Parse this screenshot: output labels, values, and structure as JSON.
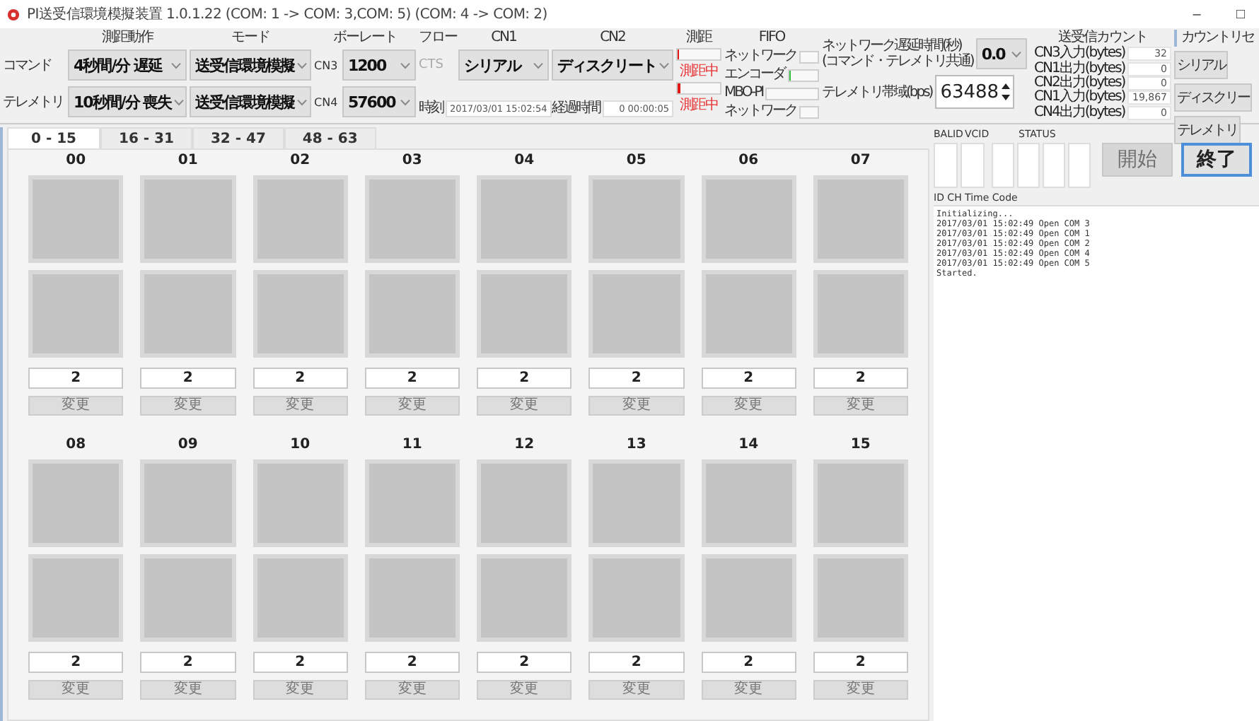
{
  "window": {
    "title": "PI送受信環境模擬装置 1.0.1.22 (COM: 1 -> COM: 3,COM: 5) (COM: 4 -> COM: 2)",
    "buttons": [
      "–",
      "□"
    ]
  },
  "settings": {
    "headers": {
      "action": "測距動作",
      "mode": "モード",
      "baud": "ボーレート",
      "flow": "フロー",
      "cn1": "CN1",
      "cn2": "CN2"
    },
    "rows": [
      {
        "label": "コマンド",
        "action": "4秒間/分 遅延",
        "mode": "送受信環境模擬",
        "port": "CN3",
        "baud": "1200"
      },
      {
        "label": "テレメトリ",
        "action": "10秒間/分 喪失",
        "mode": "送受信環境模擬",
        "port": "CN4",
        "baud": "57600"
      }
    ],
    "flow": "CTS",
    "cn1": "シリアル",
    "cn2": "ディスクリート",
    "time": {
      "label": "時刻",
      "value": "2017/03/01 15:02:54"
    },
    "elapsed": {
      "label": "経過時間",
      "value": "0 00:00:05"
    }
  },
  "ranging": {
    "header": "測距",
    "rows": [
      {
        "level": 0.04,
        "status": "測距中"
      },
      {
        "level": 0.06,
        "status": "測距中"
      }
    ]
  },
  "fifo": {
    "header": "FIFO",
    "rows": [
      {
        "label": "ネットワーク"
      },
      {
        "label": "エンコーダ",
        "level": 0.06
      },
      {
        "label": "MBO-PI"
      },
      {
        "label": "ネットワーク"
      }
    ]
  },
  "network": {
    "delay_label": "ネットワーク遅延時間(秒)\n(コマンド・テレメトリ共通)",
    "delay": "0.0",
    "bandwidth_label": "テレメトリ帯域(bps)",
    "bandwidth": "63488"
  },
  "counts": {
    "header": "送受信カウント",
    "rows": [
      {
        "label": "CN3入力(bytes)",
        "value": "32"
      },
      {
        "label": "CN1出力(bytes)",
        "value": "0"
      },
      {
        "label": "CN2出力(bytes)",
        "value": "0"
      },
      {
        "label": "CN1入力(bytes)",
        "value": "19,867"
      },
      {
        "label": "CN4出力(bytes)",
        "value": "0"
      }
    ]
  },
  "reset": {
    "header": "カウントリセ",
    "buttons": [
      "シリアル",
      "ディスクリー",
      "テレメトリ"
    ]
  },
  "tabs": [
    {
      "label": "0 - 15",
      "selected": true
    },
    {
      "label": "16 - 31",
      "selected": false
    },
    {
      "label": "32 - 47",
      "selected": false
    },
    {
      "label": "48 - 63",
      "selected": false
    }
  ],
  "channels": [
    {
      "id": "00",
      "value": "2",
      "button": "変更"
    },
    {
      "id": "01",
      "value": "2",
      "button": "変更"
    },
    {
      "id": "02",
      "value": "2",
      "button": "変更"
    },
    {
      "id": "03",
      "value": "2",
      "button": "変更"
    },
    {
      "id": "04",
      "value": "2",
      "button": "変更"
    },
    {
      "id": "05",
      "value": "2",
      "button": "変更"
    },
    {
      "id": "06",
      "value": "2",
      "button": "変更"
    },
    {
      "id": "07",
      "value": "2",
      "button": "変更"
    },
    {
      "id": "08",
      "value": "2",
      "button": "変更"
    },
    {
      "id": "09",
      "value": "2",
      "button": "変更"
    },
    {
      "id": "10",
      "value": "2",
      "button": "変更"
    },
    {
      "id": "11",
      "value": "2",
      "button": "変更"
    },
    {
      "id": "12",
      "value": "2",
      "button": "変更"
    },
    {
      "id": "13",
      "value": "2",
      "button": "変更"
    },
    {
      "id": "14",
      "value": "2",
      "button": "変更"
    },
    {
      "id": "15",
      "value": "2",
      "button": "変更"
    }
  ],
  "status_panel": {
    "headers": [
      "BALID",
      "VCID",
      "STATUS"
    ],
    "start": {
      "label": "開始",
      "disabled": true
    },
    "stop": {
      "label": "終了",
      "disabled": false
    },
    "log_header": "ID CH Time Code",
    "log": [
      "Initializing...",
      "2017/03/01 15:02:49 Open COM 3",
      "2017/03/01 15:02:49 Open COM 1",
      "2017/03/01 15:02:49 Open COM 2",
      "2017/03/01 15:02:49 Open COM 4",
      "2017/03/01 15:02:49 Open COM 5",
      "Started."
    ]
  }
}
